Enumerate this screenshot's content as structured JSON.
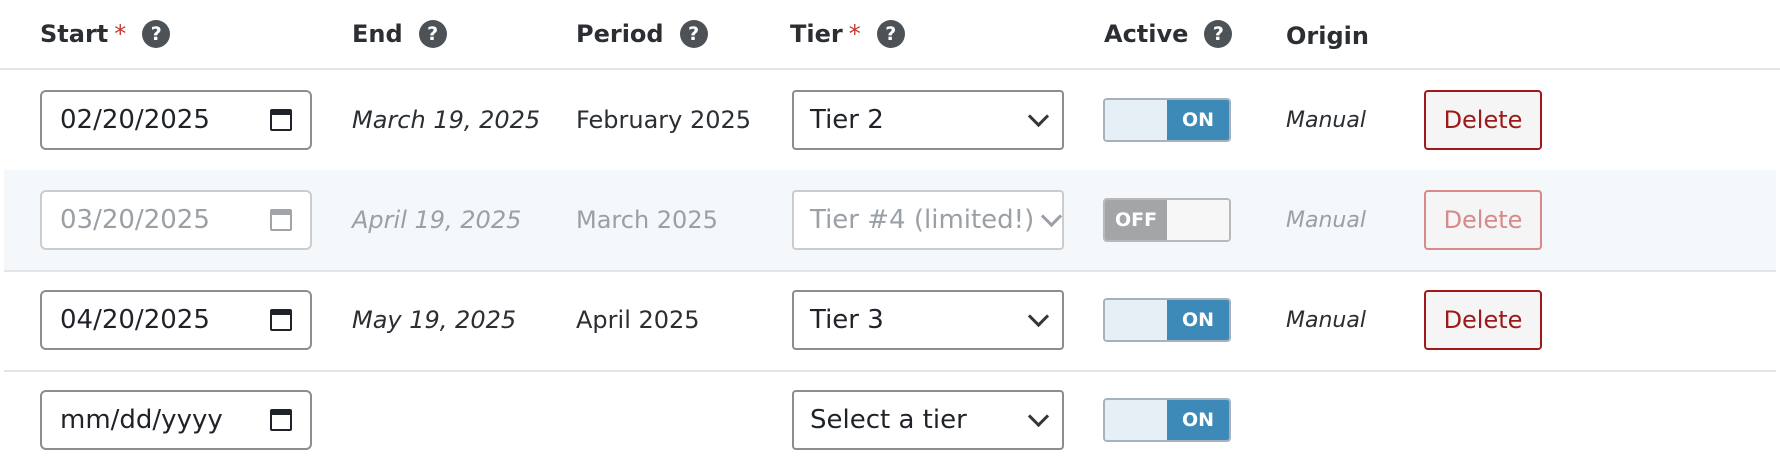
{
  "header": {
    "start": "Start",
    "end": "End",
    "period": "Period",
    "tier": "Tier",
    "active": "Active",
    "origin": "Origin",
    "required_mark": "*",
    "help_glyph": "?"
  },
  "rows": [
    {
      "start": "02/20/2025",
      "end": "March 19, 2025",
      "period": "February 2025",
      "tier": "Tier 2",
      "active_label": "ON",
      "active": true,
      "origin": "Manual",
      "delete": "Delete",
      "disabled": false
    },
    {
      "start": "03/20/2025",
      "end": "April 19, 2025",
      "period": "March 2025",
      "tier": "Tier #4 (limited!)",
      "active_label": "OFF",
      "active": false,
      "origin": "Manual",
      "delete": "Delete",
      "disabled": true
    },
    {
      "start": "04/20/2025",
      "end": "May 19, 2025",
      "period": "April 2025",
      "tier": "Tier 3",
      "active_label": "ON",
      "active": true,
      "origin": "Manual",
      "delete": "Delete",
      "disabled": false
    }
  ],
  "new_row": {
    "start_placeholder": "mm/dd/yyyy",
    "tier_placeholder": "Select a tier",
    "active_label": "ON",
    "active": true
  },
  "colors": {
    "toggle_on": "#3d8ab8",
    "toggle_off": "#a3a5a7",
    "delete": "#a01919",
    "required": "#c0392b"
  },
  "icons": {
    "help": "question-circle-icon",
    "calendar": "calendar-icon",
    "dropdown": "chevron-down-icon"
  }
}
